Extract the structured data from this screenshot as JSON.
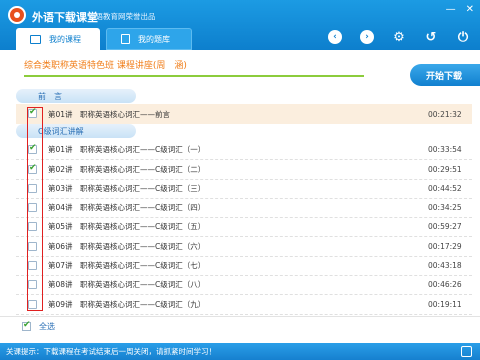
{
  "app": {
    "title": "外语下载课堂",
    "subtitle": "外语教育网荣誉出品"
  },
  "tabs": [
    {
      "label": "我的课程",
      "active": true
    },
    {
      "label": "我的题库",
      "active": false
    }
  ],
  "course": {
    "title": "综合类职称英语特色班 课程讲座(周　涵)"
  },
  "download_button": {
    "label": "开始下载"
  },
  "sections": [
    {
      "label": "前　言",
      "lessons": [
        {
          "no": "第01讲",
          "title": "职称英语核心词汇——前言",
          "duration": "00:21:32",
          "checked": true,
          "highlight": true
        }
      ]
    },
    {
      "label": "C级词汇讲解",
      "lessons": [
        {
          "no": "第01讲",
          "title": "职称英语核心词汇——C级词汇（一）",
          "duration": "00:33:54",
          "checked": true
        },
        {
          "no": "第02讲",
          "title": "职称英语核心词汇——C级词汇（二）",
          "duration": "00:29:51",
          "checked": true
        },
        {
          "no": "第03讲",
          "title": "职称英语核心词汇——C级词汇（三）",
          "duration": "00:44:52",
          "checked": false
        },
        {
          "no": "第04讲",
          "title": "职称英语核心词汇——C级词汇（四）",
          "duration": "00:34:25",
          "checked": false
        },
        {
          "no": "第05讲",
          "title": "职称英语核心词汇——C级词汇（五）",
          "duration": "00:59:27",
          "checked": false
        },
        {
          "no": "第06讲",
          "title": "职称英语核心词汇——C级词汇（六）",
          "duration": "00:17:29",
          "checked": false
        },
        {
          "no": "第07讲",
          "title": "职称英语核心词汇——C级词汇（七）",
          "duration": "00:43:18",
          "checked": false
        },
        {
          "no": "第08讲",
          "title": "职称英语核心词汇——C级词汇（八）",
          "duration": "00:46:26",
          "checked": false
        },
        {
          "no": "第09讲",
          "title": "职称英语核心词汇——C级词汇（九）",
          "duration": "00:19:11",
          "checked": false
        }
      ]
    }
  ],
  "select_all": {
    "label": "全选",
    "checked": true
  },
  "footer": {
    "text": "关课提示：下载课程在考试结束后一周关闭，请抓紧时间学习！"
  },
  "colors": {
    "header": "#1589d7",
    "accent_orange": "#f07d18",
    "highlight_row": "#fbeede",
    "annotation_red": "#e02020"
  },
  "icons": {
    "nav": [
      "back-icon",
      "forward-icon",
      "settings-icon",
      "refresh-icon",
      "power-icon"
    ]
  }
}
